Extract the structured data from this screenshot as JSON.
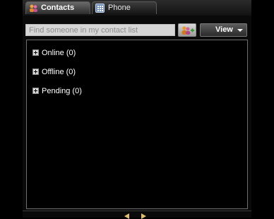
{
  "tabs": {
    "contacts": {
      "label": "Contacts",
      "icon": "contacts-people-icon"
    },
    "phone": {
      "label": "Phone",
      "icon": "phone-keypad-icon"
    }
  },
  "toolbar": {
    "search_placeholder": "Find someone in my contact list",
    "add_contact_icon": "add-contact-icon",
    "view_label": "View"
  },
  "groups": [
    {
      "label": "Online (0)"
    },
    {
      "label": "Offline (0)"
    },
    {
      "label": "Pending (0)"
    }
  ],
  "colors": {
    "background": "#000000",
    "search_field": "#d6d6d6",
    "accent_nav": "#e0c070"
  }
}
